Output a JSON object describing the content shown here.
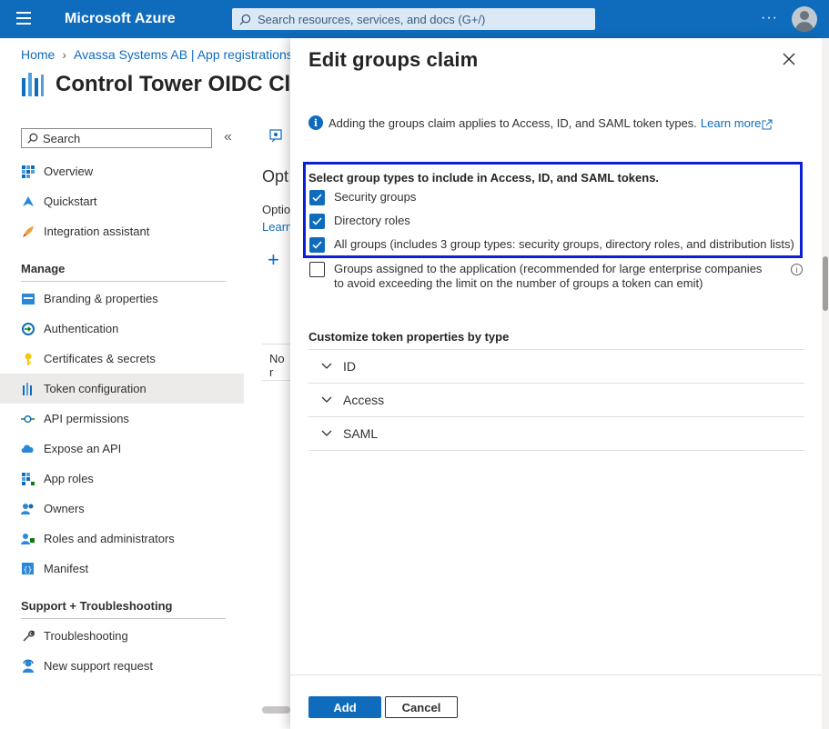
{
  "topbar": {
    "brand": "Microsoft Azure",
    "search_placeholder": "Search resources, services, and docs (G+/)",
    "more": "···"
  },
  "breadcrumb": {
    "home": "Home",
    "current": "Avassa Systems AB | App registrations"
  },
  "app": {
    "title": "Control Tower OIDC Clie"
  },
  "leftnav": {
    "search_label": "Search",
    "collapse": "«",
    "items": [
      {
        "label": "Overview"
      },
      {
        "label": "Quickstart"
      },
      {
        "label": "Integration assistant"
      }
    ],
    "manage_heading": "Manage",
    "manage_items": [
      {
        "label": "Branding & properties"
      },
      {
        "label": "Authentication"
      },
      {
        "label": "Certificates & secrets"
      },
      {
        "label": "Token configuration"
      },
      {
        "label": "API permissions"
      },
      {
        "label": "Expose an API"
      },
      {
        "label": "App roles"
      },
      {
        "label": "Owners"
      },
      {
        "label": "Roles and administrators"
      },
      {
        "label": "Manifest"
      }
    ],
    "support_heading": "Support + Troubleshooting",
    "support_items": [
      {
        "label": "Troubleshooting"
      },
      {
        "label": "New support request"
      }
    ]
  },
  "midpane": {
    "heading": "Opt",
    "line1": "Optio",
    "link": "Learn",
    "plus": "+",
    "no": "No r"
  },
  "blade": {
    "title": "Edit groups claim",
    "info_text": "Adding the groups claim applies to Access, ID, and SAML token types.",
    "info_link": "Learn more",
    "group_types_title": "Select group types to include in Access, ID, and SAML tokens.",
    "options": [
      {
        "label": "Security groups",
        "checked": true
      },
      {
        "label": "Directory roles",
        "checked": true
      },
      {
        "label": "All groups (includes 3 group types: security groups, directory roles, and distribution lists)",
        "checked": true
      }
    ],
    "assigned_option": {
      "label": "Groups assigned to the application (recommended for large enterprise companies to avoid exceeding the limit on the number of groups a token can emit)",
      "checked": false
    },
    "customize_title": "Customize token properties by type",
    "token_types": [
      {
        "label": "ID"
      },
      {
        "label": "Access"
      },
      {
        "label": "SAML"
      }
    ],
    "add_label": "Add",
    "cancel_label": "Cancel"
  },
  "colors": {
    "azure_blue": "#0f6cbd",
    "highlight_box": "#0b1fd6"
  }
}
